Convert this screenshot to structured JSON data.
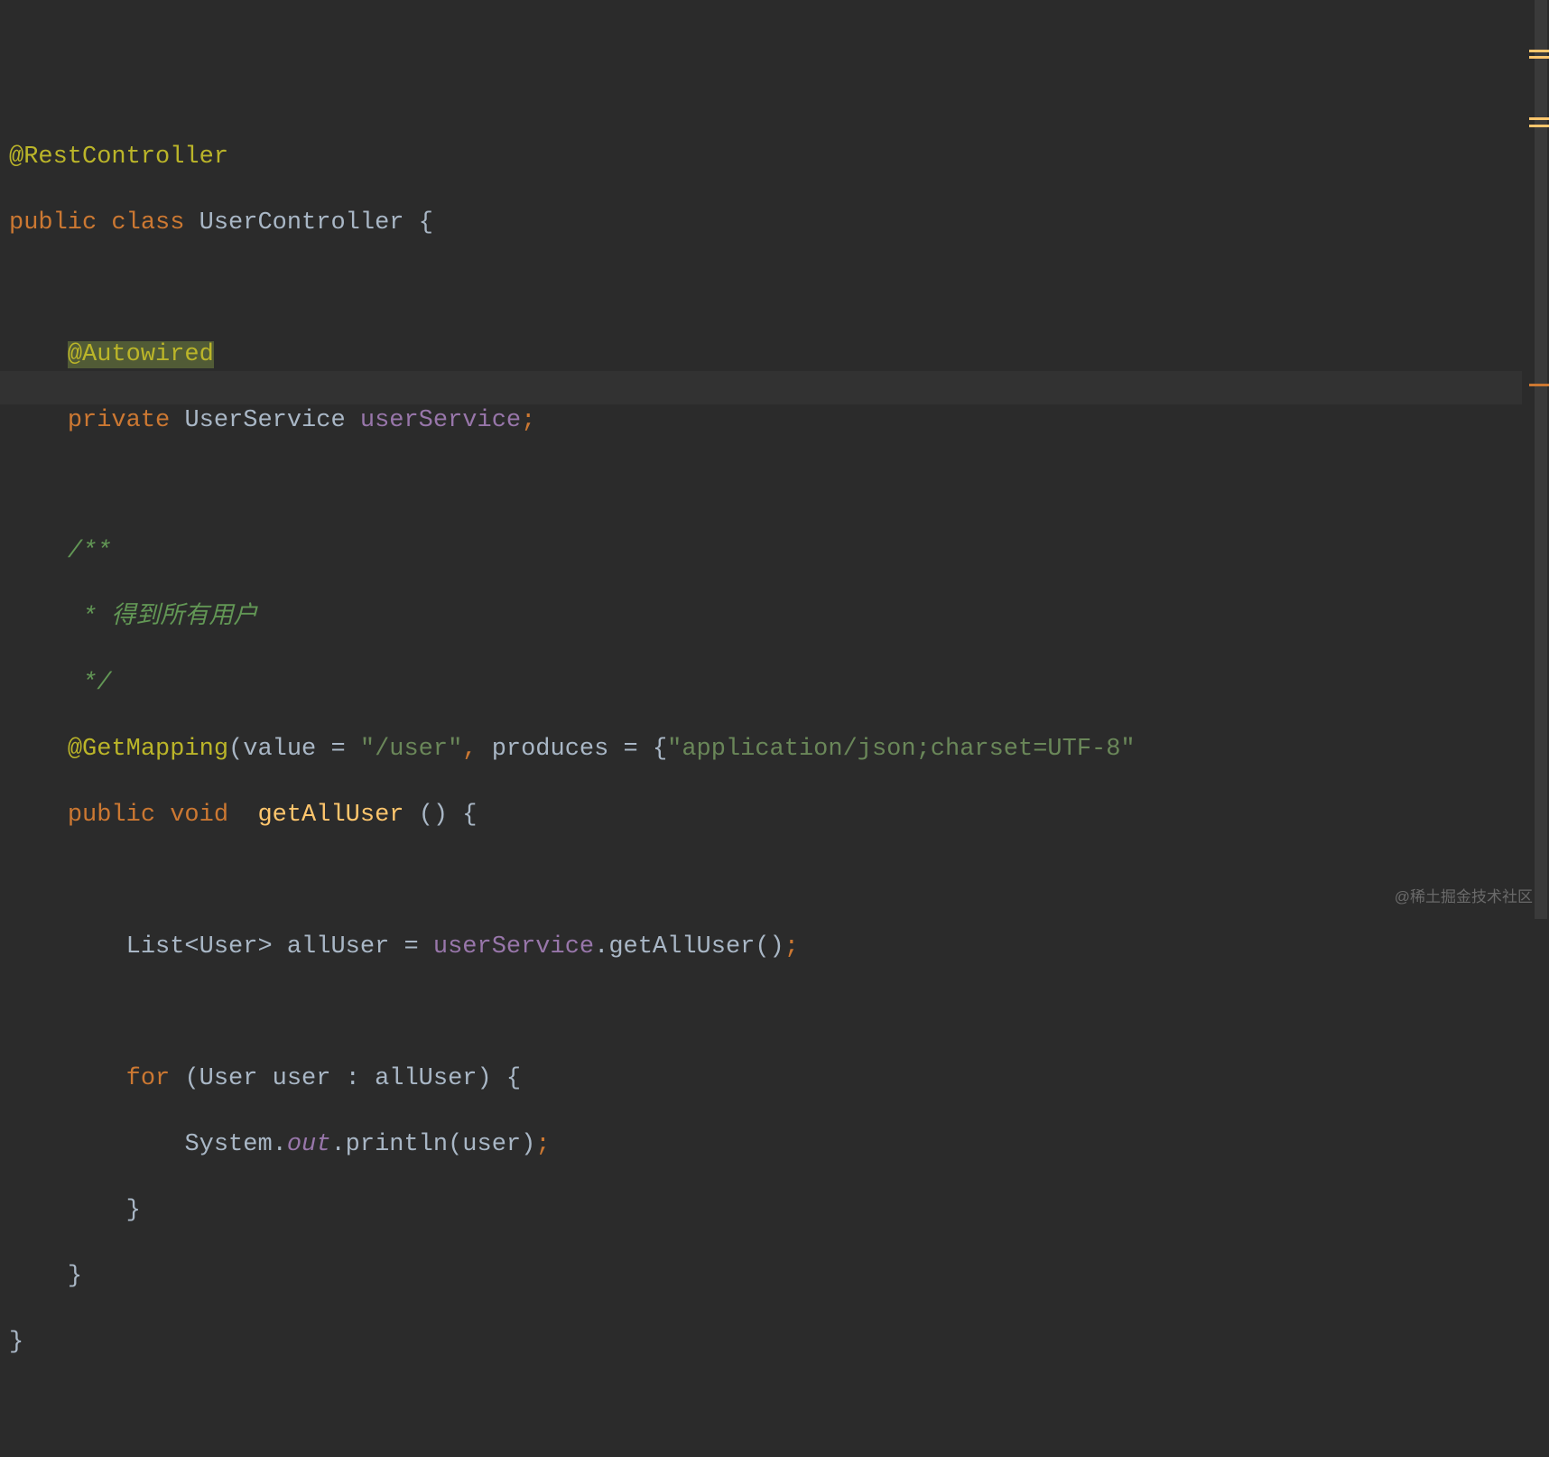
{
  "code": {
    "l1_ann": "@RestController",
    "l2_kw1": "public ",
    "l2_kw2": "class ",
    "l2_id": "UserController ",
    "l2_brace": "{",
    "l4_ann": "@Autowired",
    "l5_kw": "private ",
    "l5_type": "UserService ",
    "l5_field": "userService",
    "l5_semi": ";",
    "l7_jd1": "/**",
    "l8_jd2": " * 得到所有用户",
    "l9_jd3": " */",
    "l10_ann": "@GetMapping",
    "l10_p1": "(",
    "l10_val": "value ",
    "l10_eq1": "= ",
    "l10_str1": "\"/user\"",
    "l10_c1": ", ",
    "l10_prod": "produces ",
    "l10_eq2": "= ",
    "l10_br1": "{",
    "l10_str2": "\"application/json;charset=UTF-8\"",
    "l11_kw1": "public ",
    "l11_kw2": "void  ",
    "l11_m": "getAllUser ",
    "l11_p": "() ",
    "l11_brace": "{",
    "l13_type": "List<User> ",
    "l13_var": "allUser ",
    "l13_eq": "= ",
    "l13_fld": "userService",
    "l13_dot": ".getAllUser()",
    "l13_semi": ";",
    "l15_for": "for ",
    "l15_p": "(User user ",
    "l15_colon": ": ",
    "l15_var": "allUser) ",
    "l15_brace": "{",
    "l16_sys": "System.",
    "l16_out": "out",
    "l16_call": ".println(user)",
    "l16_semi": ";",
    "l17_brace": "}",
    "l18_brace": "}",
    "l19_brace": "}"
  },
  "watermark": "@稀土掘金技术社区",
  "indent1": "    ",
  "indent2": "        ",
  "indent3": "            "
}
